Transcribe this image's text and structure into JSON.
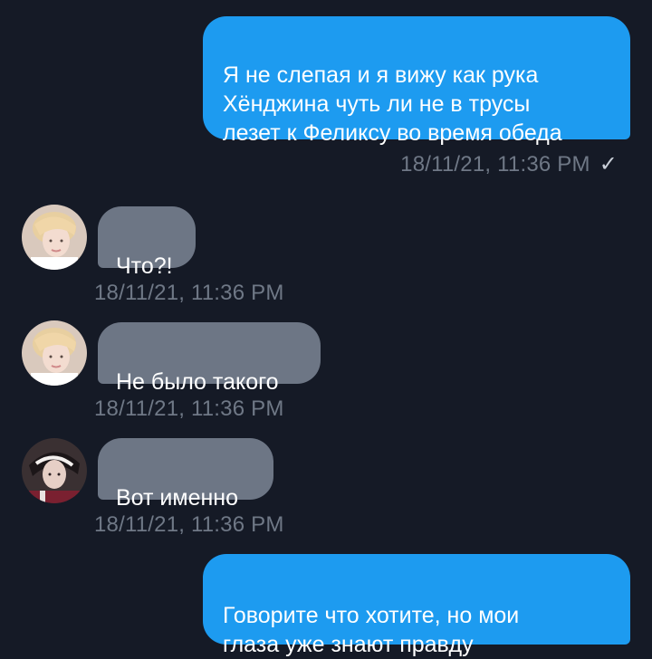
{
  "messages": [
    {
      "direction": "outgoing",
      "text": "Я не слепая и я вижу как рука\nХёнджина чуть ли не в трусы\nлезет к Феликсу во время обеда",
      "timestamp": "18/11/21, 11:36 PM",
      "status_icon": "checkmark-icon",
      "status_glyph": "✓"
    },
    {
      "direction": "incoming",
      "avatar": "user-avatar-blond",
      "text": "Что?!",
      "timestamp": "18/11/21, 11:36 PM"
    },
    {
      "direction": "incoming",
      "avatar": "user-avatar-blond",
      "text": "Не было такого",
      "timestamp": "18/11/21, 11:36 PM"
    },
    {
      "direction": "incoming",
      "avatar": "user-avatar-dark-hair",
      "text": "Вот именно",
      "timestamp": "18/11/21, 11:36 PM"
    },
    {
      "direction": "outgoing",
      "text": "Говорите что хотите, но мои\nглаза уже знают правду"
    }
  ],
  "colors": {
    "background": "#151a26",
    "outgoing_bubble": "#1d9bf0",
    "incoming_bubble": "#6d7685",
    "timestamp": "#6f7886"
  }
}
